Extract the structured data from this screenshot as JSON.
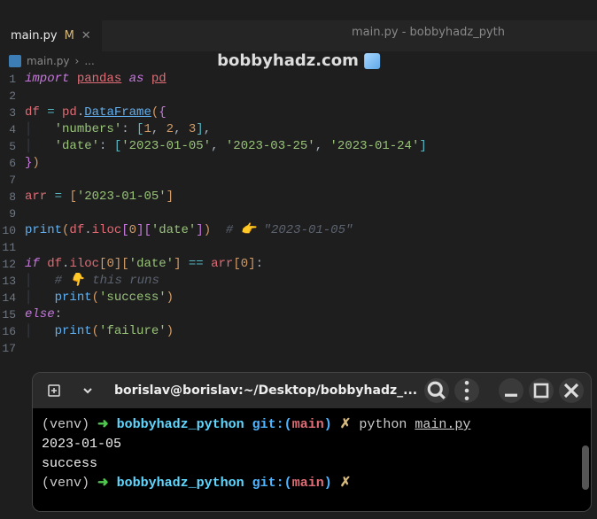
{
  "window_title": "main.py - bobbyhadz_pyth",
  "watermark": "bobbyhadz.com",
  "tab": {
    "name": "main.py",
    "modified": "M"
  },
  "breadcrumb": {
    "file": "main.py",
    "sep": "›",
    "more": "..."
  },
  "code": {
    "l1": {
      "import": "import",
      "pandas": "pandas",
      "as": "as",
      "pd": "pd"
    },
    "l3": {
      "df": "df",
      "eq": "=",
      "pd": "pd",
      "dot": ".",
      "DataFrame": "DataFrame",
      "op": "(",
      "cb": "{"
    },
    "l4": {
      "key": "'numbers'",
      "colon": ":",
      "ob": "[",
      "n1": "1",
      "c": ",",
      "n2": "2",
      "n3": "3",
      "cb": "]",
      "cm": ","
    },
    "l5": {
      "key": "'date'",
      "colon": ":",
      "ob": "[",
      "s1": "'2023-01-05'",
      "c": ",",
      "s2": "'2023-03-25'",
      "s3": "'2023-01-24'",
      "cb": "]"
    },
    "l6": {
      "cb": "}",
      "cp": ")"
    },
    "l8": {
      "arr": "arr",
      "eq": "=",
      "ob": "[",
      "s": "'2023-01-05'",
      "cb": "]"
    },
    "l10": {
      "print": "print",
      "op": "(",
      "df": "df",
      "dot": ".",
      "iloc": "iloc",
      "ob": "[",
      "z": "0",
      "cb": "]",
      "ob2": "[",
      "key": "'date'",
      "cb2": "]",
      "cp": ")",
      "cm": "# 👉️ \"2023-01-05\""
    },
    "l12": {
      "if": "if",
      "df": "df",
      "dot": ".",
      "iloc": "iloc",
      "ob": "[",
      "z": "0",
      "cb": "]",
      "ob2": "[",
      "key": "'date'",
      "cb2": "]",
      "eq": "==",
      "arr": "arr",
      "ob3": "[",
      "z2": "0",
      "cb3": "]",
      "colon": ":"
    },
    "l13": {
      "cm": "# 👇️ this runs"
    },
    "l14": {
      "print": "print",
      "op": "(",
      "s": "'success'",
      "cp": ")"
    },
    "l15": {
      "else": "else",
      "colon": ":"
    },
    "l16": {
      "print": "print",
      "op": "(",
      "s": "'failure'",
      "cp": ")"
    }
  },
  "line_count": 17,
  "terminal": {
    "title": "borislav@borislav:~/Desktop/bobbyhadz_...",
    "prompt1": {
      "venv": "(venv)",
      "arrow": "➜",
      "dir": "bobbyhadz_python",
      "git": "git:(",
      "branch": "main",
      "gitc": ")",
      "x": "✗",
      "cmd": "python",
      "file": "main.py"
    },
    "out1": "2023-01-05",
    "out2": "success",
    "prompt2": {
      "venv": "(venv)",
      "arrow": "➜",
      "dir": "bobbyhadz_python",
      "git": "git:(",
      "branch": "main",
      "gitc": ")",
      "x": "✗"
    }
  }
}
